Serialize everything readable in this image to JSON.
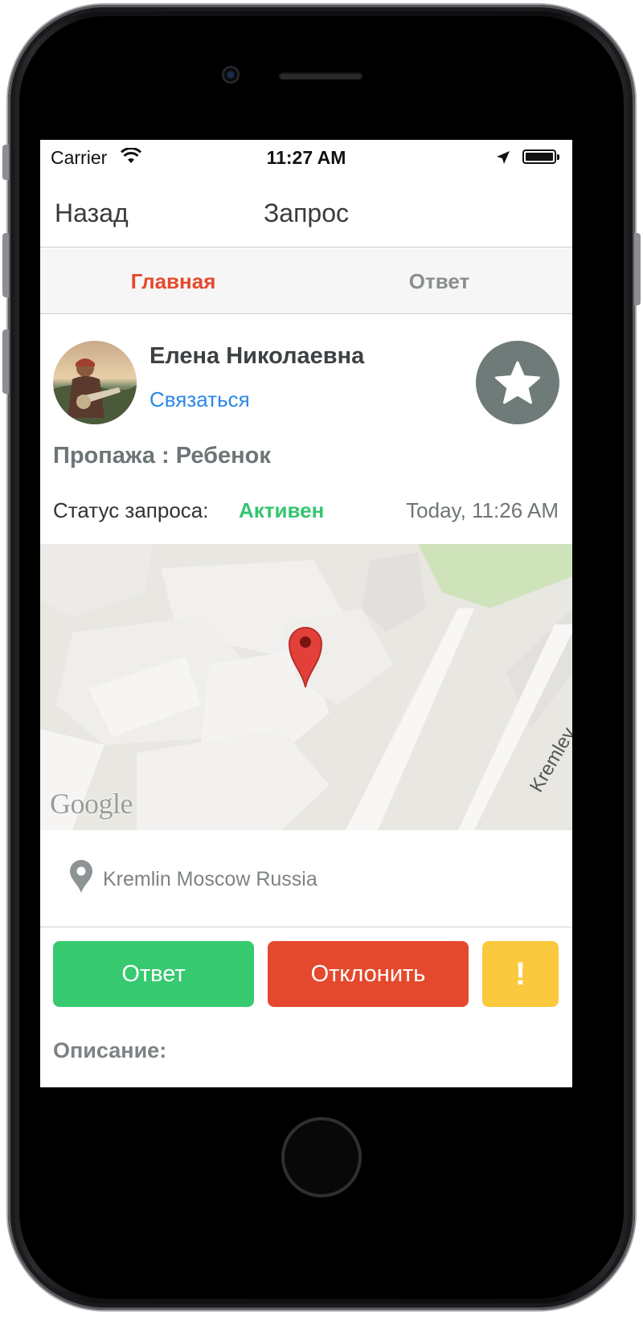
{
  "status_bar": {
    "carrier": "Carrier",
    "time": "11:27 AM"
  },
  "nav": {
    "back_label": "Назад",
    "title": "Запрос"
  },
  "tabs": [
    {
      "label": "Главная",
      "active": true
    },
    {
      "label": "Ответ",
      "active": false
    }
  ],
  "request": {
    "user_name": "Елена Николаевна",
    "contact_label": "Связаться",
    "loss_line": "Пропажа : Ребенок",
    "status_label": "Статус запроса:",
    "status_value": "Активен",
    "timestamp": "Today, 11:26 AM"
  },
  "map": {
    "logo": "Google",
    "street_label": "Kremlev"
  },
  "address": "Kremlin Moscow Russia",
  "actions": {
    "answer_label": "Ответ",
    "decline_label": "Отклонить",
    "alert_label": "!"
  },
  "description_label": "Описание:",
  "colors": {
    "accent_red": "#e5492d",
    "green": "#37c96f",
    "yellow": "#fbc93d",
    "link_blue": "#2b88e8",
    "star_bg": "#6e7b79"
  },
  "icons": {
    "wifi": "wifi-icon",
    "location_arrow": "location-arrow-icon",
    "battery": "battery-icon",
    "star": "star-icon",
    "map_pin": "map-pin-icon",
    "marker": "map-marker-icon"
  }
}
